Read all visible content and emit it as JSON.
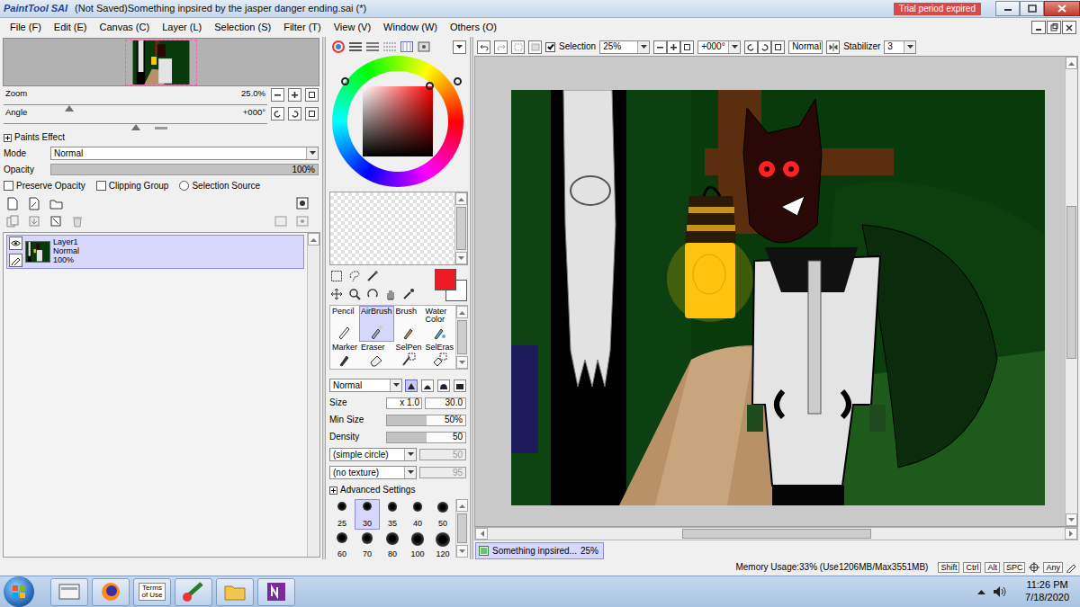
{
  "app": {
    "logo": "PaintTool SAI",
    "title": "(Not Saved)Something inpsired by the jasper danger ending.sai (*)",
    "trial": "Trial period expired"
  },
  "menu": [
    "File (F)",
    "Edit (E)",
    "Canvas (C)",
    "Layer (L)",
    "Selection (S)",
    "Filter (T)",
    "View (V)",
    "Window (W)",
    "Others (O)"
  ],
  "navigator": {
    "zoom": {
      "label": "Zoom",
      "reading": "25.0%",
      "level": 0.25
    },
    "angle": {
      "label": "Angle",
      "reading": "+000°",
      "level": 0.5
    }
  },
  "paints_effect": {
    "header": "Paints Effect",
    "expanded": false,
    "mode_label": "Mode",
    "mode": "Normal",
    "opacity_label": "Opacity",
    "opacity": "100%",
    "opacity_level": 1,
    "options": [
      {
        "label": "Preserve Opacity",
        "kind": "checkbox",
        "checked": false
      },
      {
        "label": "Clipping Group",
        "kind": "checkbox",
        "checked": false
      },
      {
        "label": "Selection Source",
        "kind": "radio",
        "checked": false
      }
    ]
  },
  "layers": [
    {
      "name": "Layer1",
      "mode": "Normal",
      "opacity": "100%",
      "visible": true,
      "selected": true
    }
  ],
  "colors": {
    "primary": "#ed1c24",
    "secondary": "#ffffff"
  },
  "tools": [
    {
      "label": "Pencil",
      "selected": false
    },
    {
      "label": "AirBrush",
      "selected": true
    },
    {
      "label": "Brush",
      "selected": false
    },
    {
      "label": "Water Color",
      "selected": false
    },
    {
      "label": "Marker",
      "selected": false
    },
    {
      "label": "Eraser",
      "selected": false
    },
    {
      "label": "SelPen",
      "selected": false
    },
    {
      "label": "SelEras",
      "selected": false
    }
  ],
  "brush": {
    "blend": "Normal",
    "tip_shapes": [
      {
        "selected": true
      },
      {
        "selected": false
      },
      {
        "selected": false
      },
      {
        "selected": false
      }
    ],
    "size_label": "Size",
    "size_multiplier": "x 1.0",
    "size": "30.0",
    "min_size_label": "Min Size",
    "min_size": "50%",
    "min_size_level": 0.5,
    "density_label": "Density",
    "density": "50",
    "density_level": 0.5,
    "shape": "(simple circle)",
    "shape_value": "50",
    "shape_value_disabled": true,
    "texture": "(no texture)",
    "texture_value": "95",
    "texture_value_disabled": true,
    "advanced": {
      "label": "Advanced Settings",
      "expanded": false
    },
    "presets": [
      {
        "size": "25",
        "selected": false
      },
      {
        "size": "30",
        "selected": true
      },
      {
        "size": "35",
        "selected": false
      },
      {
        "size": "40",
        "selected": false
      },
      {
        "size": "50",
        "selected": false
      },
      {
        "size": "60",
        "selected": false
      },
      {
        "size": "70",
        "selected": false
      },
      {
        "size": "80",
        "selected": false
      },
      {
        "size": "100",
        "selected": false
      },
      {
        "size": "120",
        "selected": false
      }
    ]
  },
  "canvas_toolbar": {
    "selection": {
      "label": "Selection",
      "checked": true
    },
    "zoom": "25%",
    "angle": "+000°",
    "mode": "Normal",
    "stabilizer_label": "Stabilizer",
    "stabilizer": "3"
  },
  "document_tab": {
    "label": "Something inpsired...",
    "zoom": "25%",
    "selected": true
  },
  "status_bar": {
    "memory": "Memory Usage:33% (Use1206MB/Max3551MB)",
    "keys": [
      "Shift",
      "Ctrl",
      "Alt",
      "SPC",
      "Any"
    ]
  },
  "taskbar": {
    "pinned_label": "Terms of Use",
    "time": "11:26 PM",
    "date": "7/18/2020"
  }
}
